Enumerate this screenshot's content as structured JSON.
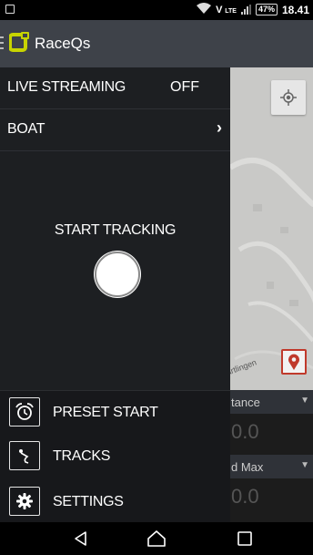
{
  "status_bar": {
    "volte": "V⁠ᴸᴴ",
    "battery": "47%",
    "time": "18.41"
  },
  "app_bar": {
    "title": "RaceQs"
  },
  "drawer": {
    "live_streaming_label": "LIVE STREAMING",
    "live_streaming_value": "OFF",
    "boat_label": "BOAT",
    "start_tracking_label": "START TRACKING",
    "menu": [
      {
        "label": "PRESET START",
        "icon": "alarm-clock-icon"
      },
      {
        "label": "TRACKS",
        "icon": "track-icon"
      },
      {
        "label": "SETTINGS",
        "icon": "gear-icon"
      }
    ]
  },
  "stats": {
    "distance_label": "tance",
    "distance_value": "0.0",
    "speed_max_label": "d Max",
    "speed_max_value": "0.0"
  },
  "map": {
    "place_label": "artlingen"
  },
  "colors": {
    "drawer_bg": "#1d1f22",
    "app_bar_bg": "#3e4249",
    "logo_yellow": "#c8d400",
    "pin_red": "#c0392b"
  }
}
